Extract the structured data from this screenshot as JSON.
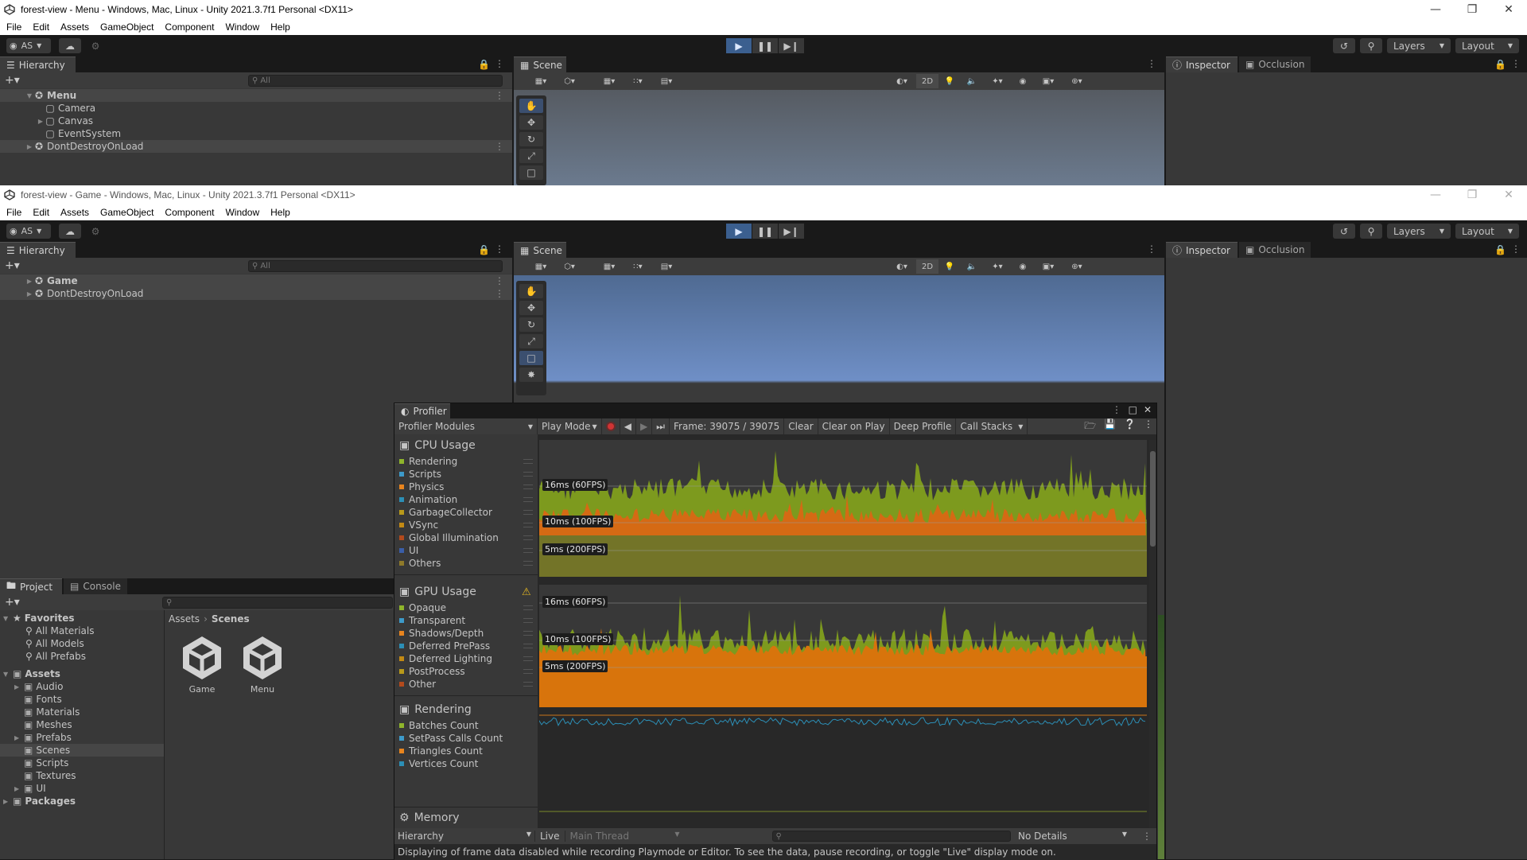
{
  "window_back": {
    "title": "forest-view - Menu - Windows, Mac, Linux - Unity 2021.3.7f1 Personal <DX11>",
    "menu": [
      "File",
      "Edit",
      "Assets",
      "GameObject",
      "Component",
      "Window",
      "Help"
    ],
    "account": "AS",
    "layers": "Layers",
    "layout": "Layout",
    "hierarchy_tab": "Hierarchy",
    "search_placeholder": "All",
    "hierarchy": [
      {
        "label": "Menu",
        "depth": 0,
        "bold": true,
        "expanded": true,
        "selected": true
      },
      {
        "label": "Camera",
        "depth": 1
      },
      {
        "label": "Canvas",
        "depth": 1,
        "collapsed": true
      },
      {
        "label": "EventSystem",
        "depth": 1
      },
      {
        "label": "DontDestroyOnLoad",
        "depth": 0,
        "collapsed": true,
        "selected": true
      }
    ],
    "scene_tab": "Scene",
    "inspector_tab": "Inspector",
    "occlusion_tab": "Occlusion",
    "btn_2d": "2D"
  },
  "window_front": {
    "title": "forest-view - Game - Windows, Mac, Linux - Unity 2021.3.7f1 Personal <DX11>",
    "menu": [
      "File",
      "Edit",
      "Assets",
      "GameObject",
      "Component",
      "Window",
      "Help"
    ],
    "account": "AS",
    "layers": "Layers",
    "layout": "Layout",
    "hierarchy_tab": "Hierarchy",
    "search_placeholder": "All",
    "hierarchy": [
      {
        "label": "Game",
        "bold": true,
        "selected": true
      },
      {
        "label": "DontDestroyOnLoad",
        "selected": true
      }
    ],
    "scene_tab": "Scene",
    "inspector_tab": "Inspector",
    "occlusion_tab": "Occlusion",
    "btn_2d": "2D"
  },
  "project": {
    "project_tab": "Project",
    "console_tab": "Console",
    "favorites": "Favorites",
    "favorite_items": [
      "All Materials",
      "All Models",
      "All Prefabs"
    ],
    "assets": "Assets",
    "asset_folders": [
      {
        "label": "Audio",
        "collapsed": true
      },
      {
        "label": "Fonts"
      },
      {
        "label": "Materials"
      },
      {
        "label": "Meshes"
      },
      {
        "label": "Prefabs",
        "collapsed": true
      },
      {
        "label": "Scenes",
        "selected": true
      },
      {
        "label": "Scripts"
      },
      {
        "label": "Textures"
      },
      {
        "label": "UI",
        "collapsed": true
      }
    ],
    "packages": "Packages",
    "breadcrumb": [
      "Assets",
      "Scenes"
    ],
    "files": [
      "Game",
      "Menu"
    ]
  },
  "profiler": {
    "title": "Profiler",
    "modules_dropdown": "Profiler Modules",
    "play_mode": "Play Mode",
    "frame": "Frame: 39075 / 39075",
    "clear": "Clear",
    "clear_on_play": "Clear on Play",
    "deep_profile": "Deep Profile",
    "call_stacks": "Call Stacks",
    "cpu": {
      "title": "CPU Usage",
      "items": [
        {
          "label": "Rendering",
          "color": "#8fb52b"
        },
        {
          "label": "Scripts",
          "color": "#3d9ac9"
        },
        {
          "label": "Physics",
          "color": "#e8851e"
        },
        {
          "label": "Animation",
          "color": "#2c8fb6"
        },
        {
          "label": "GarbageCollector",
          "color": "#b99a1a"
        },
        {
          "label": "VSync",
          "color": "#c38a14"
        },
        {
          "label": "Global Illumination",
          "color": "#b34a1c"
        },
        {
          "label": "UI",
          "color": "#3a5ea8"
        },
        {
          "label": "Others",
          "color": "#8f7a2a"
        }
      ],
      "markers": [
        "16ms (60FPS)",
        "10ms (100FPS)",
        "5ms (200FPS)"
      ]
    },
    "gpu": {
      "title": "GPU Usage",
      "items": [
        {
          "label": "Opaque",
          "color": "#8fb52b"
        },
        {
          "label": "Transparent",
          "color": "#3d9ac9"
        },
        {
          "label": "Shadows/Depth",
          "color": "#e8851e"
        },
        {
          "label": "Deferred PrePass",
          "color": "#2c8fb6"
        },
        {
          "label": "Deferred Lighting",
          "color": "#c38a14"
        },
        {
          "label": "PostProcess",
          "color": "#b99a1a"
        },
        {
          "label": "Other",
          "color": "#b34a1c"
        }
      ],
      "markers": [
        "16ms (60FPS)",
        "10ms (100FPS)",
        "5ms (200FPS)"
      ]
    },
    "rendering": {
      "title": "Rendering",
      "items": [
        {
          "label": "Batches Count",
          "color": "#8fb52b"
        },
        {
          "label": "SetPass Calls Count",
          "color": "#3d9ac9"
        },
        {
          "label": "Triangles Count",
          "color": "#e8851e"
        },
        {
          "label": "Vertices Count",
          "color": "#2c8fb6"
        }
      ]
    },
    "memory_title": "Memory",
    "bottom": {
      "view": "Hierarchy",
      "live": "Live",
      "thread": "Main Thread",
      "details": "No Details"
    },
    "status": "Displaying of frame data disabled while recording Playmode or Editor. To see the data, pause recording, or toggle \"Live\" display mode on."
  }
}
